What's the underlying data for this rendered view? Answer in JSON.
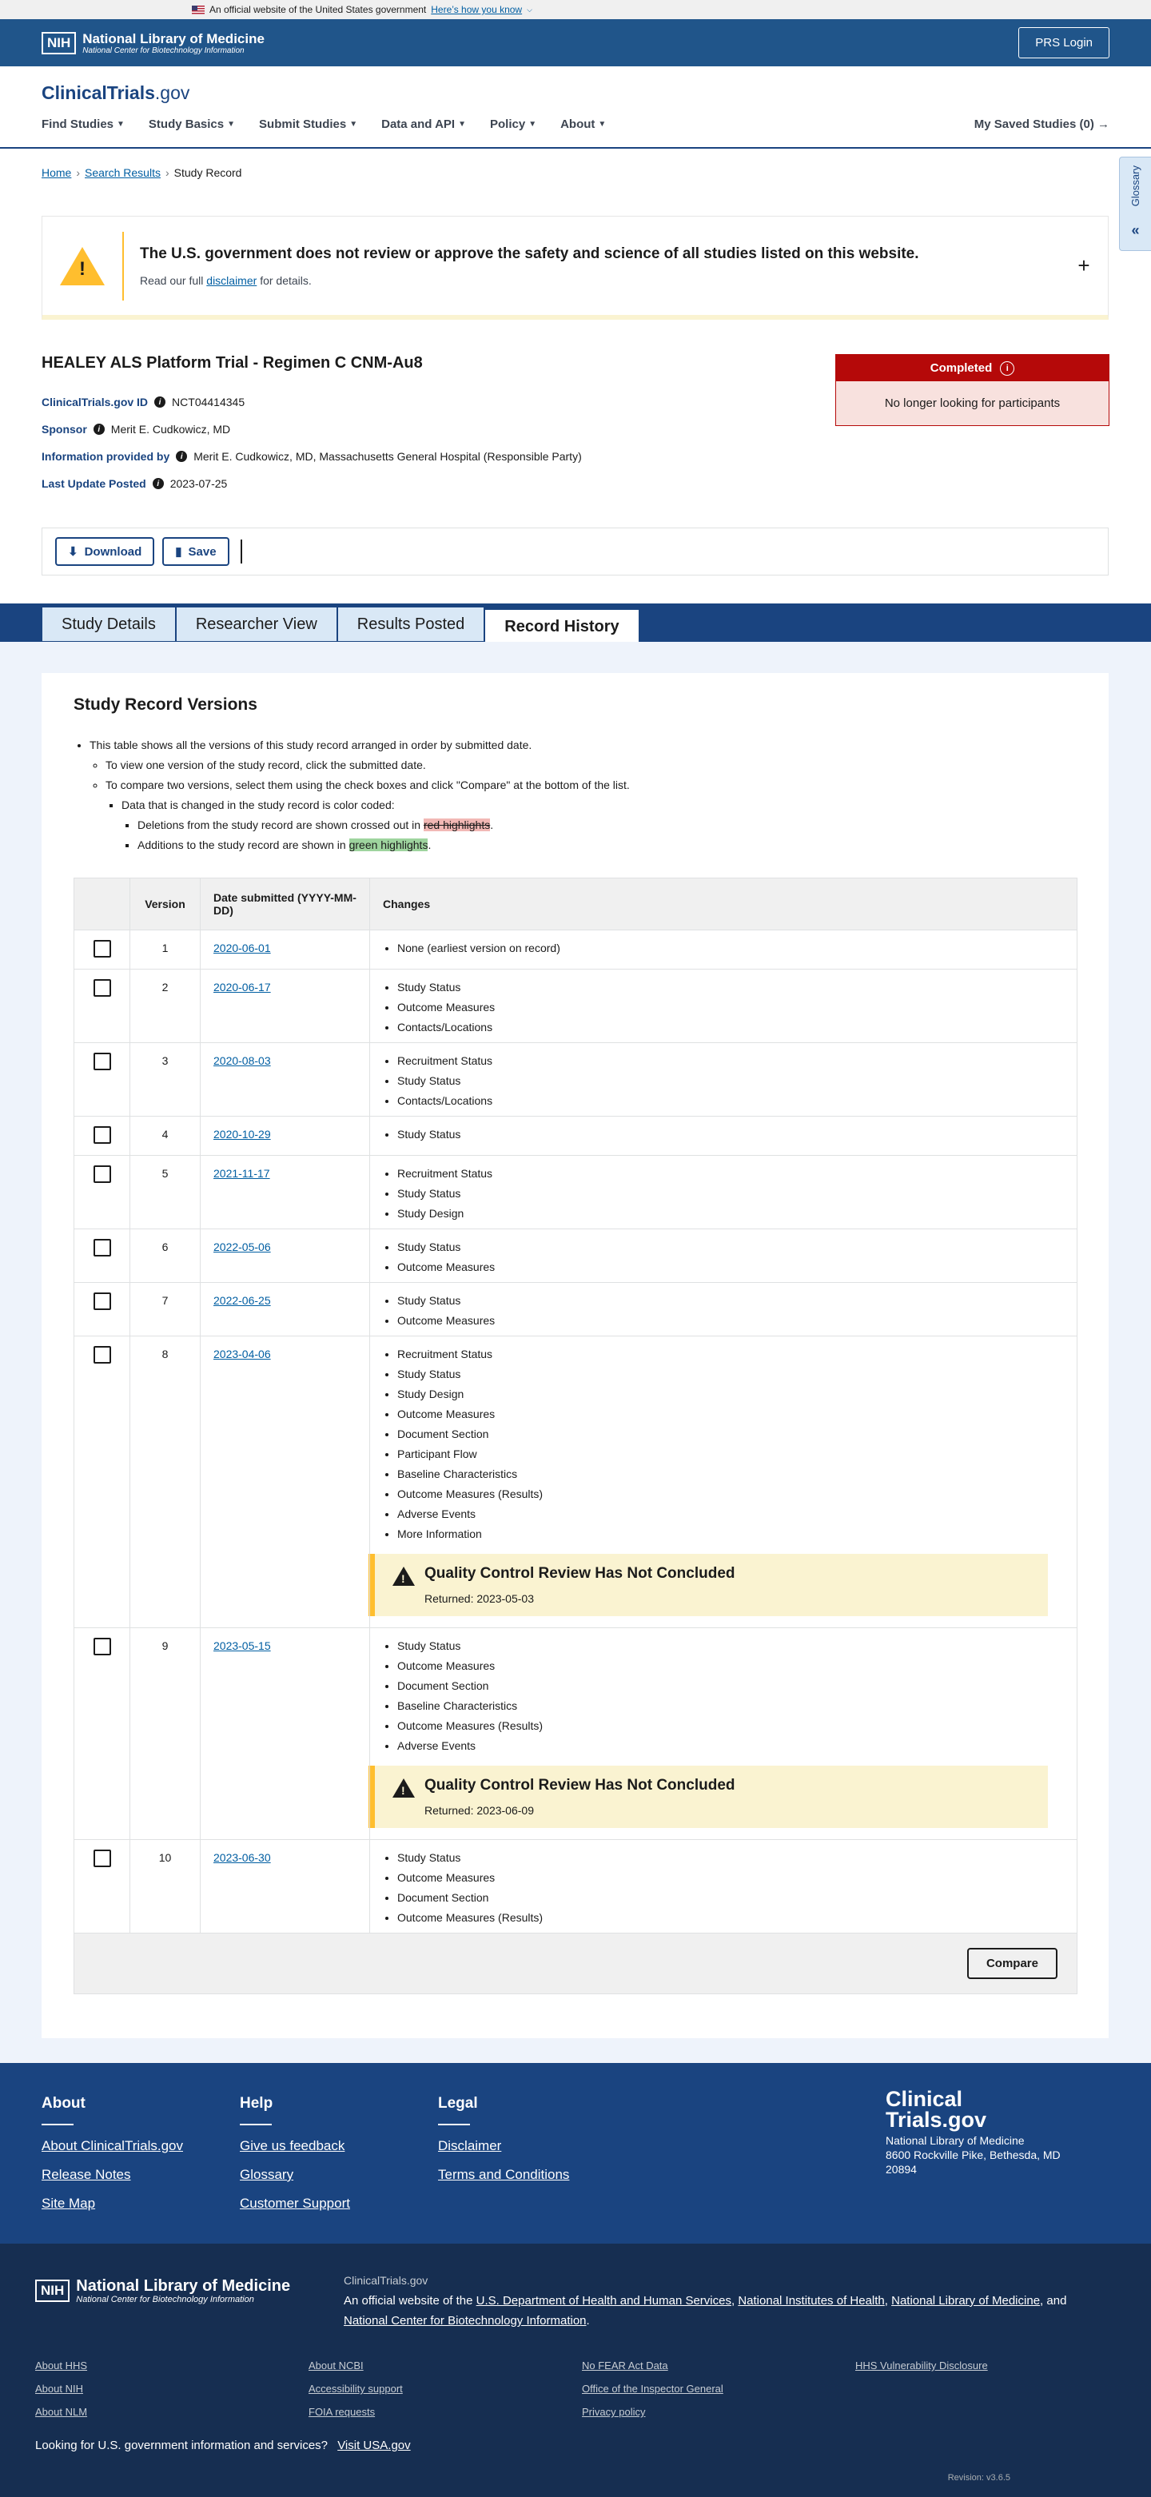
{
  "gov_banner": {
    "text": "An official website of the United States government",
    "link": "Here’s how you know"
  },
  "nih_header": {
    "logo_box": "NIH",
    "title": "National Library of Medicine",
    "subtitle": "National Center for Biotechnology Information",
    "prs_login": "PRS Login"
  },
  "site": {
    "logo_main": "ClinicalTrials",
    "logo_suffix": ".gov"
  },
  "nav": {
    "items": [
      "Find Studies",
      "Study Basics",
      "Submit Studies",
      "Data and API",
      "Policy",
      "About"
    ],
    "saved": "My Saved Studies (0)"
  },
  "breadcrumb": {
    "home": "Home",
    "search": "Search Results",
    "current": "Study Record"
  },
  "glossary": {
    "label": "Glossary"
  },
  "alert": {
    "title": "The U.S. government does not review or approve the safety and science of all studies listed on this website.",
    "text_before": "Read our full",
    "link": "disclaimer",
    "text_after": "for details."
  },
  "study": {
    "title": "HEALEY ALS Platform Trial - Regimen C CNM-Au8",
    "id_label": "ClinicalTrials.gov ID",
    "id_value": "NCT04414345",
    "sponsor_label": "Sponsor",
    "sponsor_value": "Merit E. Cudkowicz, MD",
    "info_label": "Information provided by",
    "info_value": "Merit E. Cudkowicz, MD, Massachusetts General Hospital (Responsible Party)",
    "update_label": "Last Update Posted",
    "update_value": "2023-07-25",
    "status": "Completed",
    "status_detail": "No longer looking for participants",
    "status_color": "#b50909"
  },
  "actions": {
    "download": "Download",
    "save": "Save"
  },
  "tabs": [
    "Study Details",
    "Researcher View",
    "Results Posted",
    "Record History"
  ],
  "versions_section": {
    "heading": "Study Record Versions",
    "intro_1": "This table shows all the versions of this study record arranged in order by submitted date.",
    "intro_2": "To view one version of the study record, click the submitted date.",
    "intro_3": "To compare two versions, select them using the check boxes and click \"Compare\" at the bottom of the list.",
    "intro_4": "Data that is changed in the study record is color coded:",
    "intro_5_before": "Deletions from the study record are shown crossed out in",
    "intro_5_hl": "red highlights",
    "intro_6_before": "Additions to the study record are shown in",
    "intro_6_hl": "green highlights",
    "col_version": "Version",
    "col_date": "Date submitted (YYYY-MM-DD)",
    "col_changes": "Changes",
    "compare": "Compare"
  },
  "versions": [
    {
      "version": "1",
      "date": "2020-06-01",
      "changes": [
        "None (earliest version on record)"
      ]
    },
    {
      "version": "2",
      "date": "2020-06-17",
      "changes": [
        "Study Status",
        "Outcome Measures",
        "Contacts/Locations"
      ]
    },
    {
      "version": "3",
      "date": "2020-08-03",
      "changes": [
        "Recruitment Status",
        "Study Status",
        "Contacts/Locations"
      ]
    },
    {
      "version": "4",
      "date": "2020-10-29",
      "changes": [
        "Study Status"
      ]
    },
    {
      "version": "5",
      "date": "2021-11-17",
      "changes": [
        "Recruitment Status",
        "Study Status",
        "Study Design"
      ]
    },
    {
      "version": "6",
      "date": "2022-05-06",
      "changes": [
        "Study Status",
        "Outcome Measures"
      ]
    },
    {
      "version": "7",
      "date": "2022-06-25",
      "changes": [
        "Study Status",
        "Outcome Measures"
      ]
    },
    {
      "version": "8",
      "date": "2023-04-06",
      "changes": [
        "Recruitment Status",
        "Study Status",
        "Study Design",
        "Outcome Measures",
        "Document Section",
        "Participant Flow",
        "Baseline Characteristics",
        "Outcome Measures (Results)",
        "Adverse Events",
        "More Information"
      ],
      "qc_title": "Quality Control Review Has Not Concluded",
      "qc_returned": "Returned: 2023-05-03"
    },
    {
      "version": "9",
      "date": "2023-05-15",
      "changes": [
        "Study Status",
        "Outcome Measures",
        "Document Section",
        "Baseline Characteristics",
        "Outcome Measures (Results)",
        "Adverse Events"
      ],
      "qc_title": "Quality Control Review Has Not Concluded",
      "qc_returned": "Returned: 2023-06-09"
    },
    {
      "version": "10",
      "date": "2023-06-30",
      "changes": [
        "Study Status",
        "Outcome Measures",
        "Document Section",
        "Outcome Measures (Results)"
      ]
    }
  ],
  "footer": {
    "about_heading": "About",
    "about_links": [
      "About ClinicalTrials.gov",
      "Release Notes",
      "Site Map"
    ],
    "help_heading": "Help",
    "help_links": [
      "Give us feedback",
      "Glossary",
      "Customer Support"
    ],
    "legal_heading": "Legal",
    "legal_links": [
      "Disclaimer",
      "Terms and Conditions"
    ],
    "logo_line1": "Clinical",
    "logo_line2": "Trials.gov",
    "address_1": "National Library of Medicine",
    "address_2": "8600 Rockville Pike, Bethesda, MD",
    "address_3": "20894"
  },
  "footer_bottom": {
    "site_name": "ClinicalTrials.gov",
    "official_prefix": "An official website of the",
    "dept_hhs": "U.S. Department of Health and Human Services",
    "nih": "National Institutes of Health",
    "nlm": "National Library of Medicine",
    "and": "and",
    "ncbi": "National Center for Biotechnology Information",
    "col1": [
      "About HHS",
      "About NIH",
      "About NLM"
    ],
    "col2": [
      "About NCBI",
      "Accessibility support",
      "FOIA requests"
    ],
    "col3": [
      "No FEAR Act Data",
      "Office of the Inspector General",
      "Privacy policy"
    ],
    "col4": [
      "HHS Vulnerability Disclosure"
    ],
    "usa_text": "Looking for U.S. government information and services?",
    "usa_link": "Visit USA.gov",
    "revision": "Revision: v3.6.5"
  }
}
